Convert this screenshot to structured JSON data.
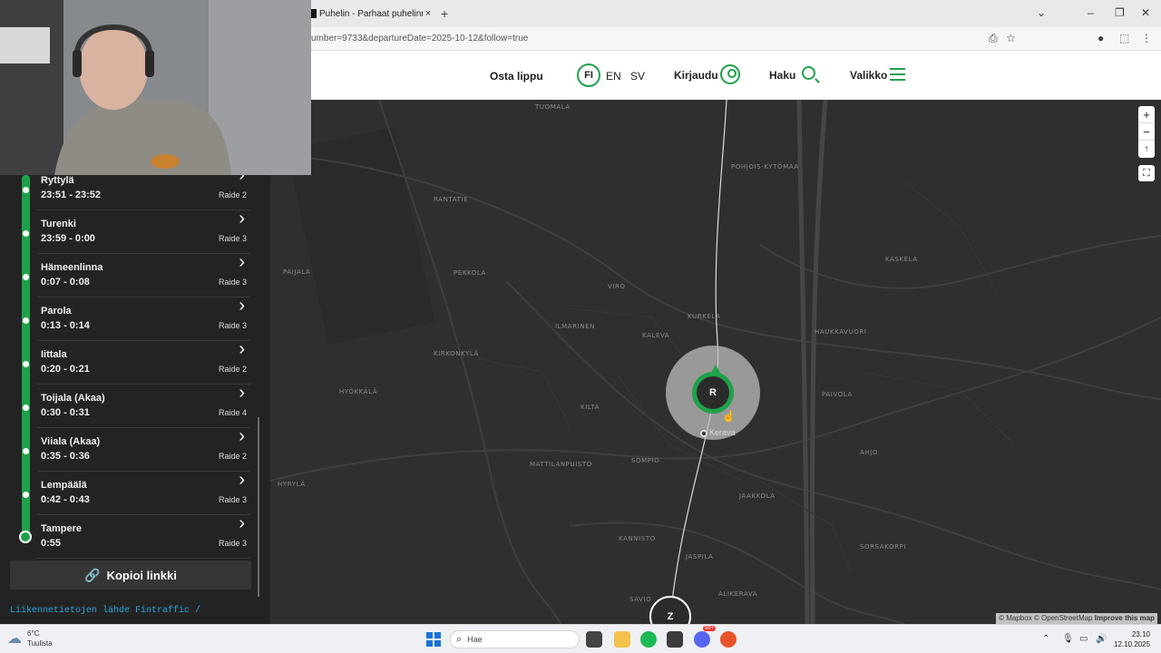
{
  "browser": {
    "tab_title": "Puhelin - Parhaat puhelinmallit",
    "tab_close": "×",
    "new_tab": "+",
    "url_fragment": "umber=9733&departureDate=2025-10-12&follow=true",
    "win_minimize": "–",
    "win_restore": "❐",
    "win_close": "✕",
    "tabs_dropdown": "⌄"
  },
  "header": {
    "buy_ticket": "Osta lippu",
    "lang_fi": "FI",
    "lang_en": "EN",
    "lang_sv": "SV",
    "login": "Kirjaudu",
    "search": "Haku",
    "menu": "Valikko"
  },
  "map": {
    "places": [
      "TUOMALA",
      "POHJOIS-KYTÖMAA",
      "RANTATIE",
      "PAIJALA",
      "PEKKOLA",
      "VIRO",
      "KASKELA",
      "ILMARINEN",
      "KURKELA",
      "KALEVA",
      "KIRKONKYLÄ",
      "HAUKKAVUORI",
      "HYÖKKÄLÄ",
      "KILTA",
      "PAIVOLA",
      "AHJO",
      "MATTILANPUISTO",
      "SOMPIO",
      "HYRYLÄ",
      "JAAKKOLA",
      "KANNISTO",
      "JASPILA",
      "SORSAKORPI",
      "SAVIO",
      "ALIKERAVA"
    ],
    "station_marker": "R",
    "station_label": "Kerava",
    "next_marker": "Z",
    "zoom_in": "+",
    "zoom_out": "−",
    "reset_north": "↑",
    "fullscreen": "⛶",
    "attribution": "© Mapbox © OpenStreetMap",
    "improve": "Improve this map"
  },
  "stops": [
    {
      "name": "Ryttylä",
      "time": "23:51 - 23:52",
      "track": "Raide 2"
    },
    {
      "name": "Turenki",
      "time": "23:59 - 0:00",
      "track": "Raide 3"
    },
    {
      "name": "Hämeenlinna",
      "time": "0:07 - 0:08",
      "track": "Raide 3"
    },
    {
      "name": "Parola",
      "time": "0:13 - 0:14",
      "track": "Raide 3"
    },
    {
      "name": "Iittala",
      "time": "0:20 - 0:21",
      "track": "Raide 2"
    },
    {
      "name": "Toijala (Akaa)",
      "time": "0:30 - 0:31",
      "track": "Raide 4"
    },
    {
      "name": "Viiala (Akaa)",
      "time": "0:35 - 0:36",
      "track": "Raide 2"
    },
    {
      "name": "Lempäälä",
      "time": "0:42 - 0:43",
      "track": "Raide 3"
    },
    {
      "name": "Tampere",
      "time": "0:55",
      "track": "Raide 3"
    }
  ],
  "copy_link": "Kopioi linkki",
  "source_text": "Liikennetietojen lähde Fintraffic /",
  "taskbar": {
    "temperature": "6°C",
    "weather": "Tuulista",
    "search_placeholder": "Hae",
    "time": "23.10",
    "date": "12.10.2025",
    "discord_badge": "99+"
  }
}
